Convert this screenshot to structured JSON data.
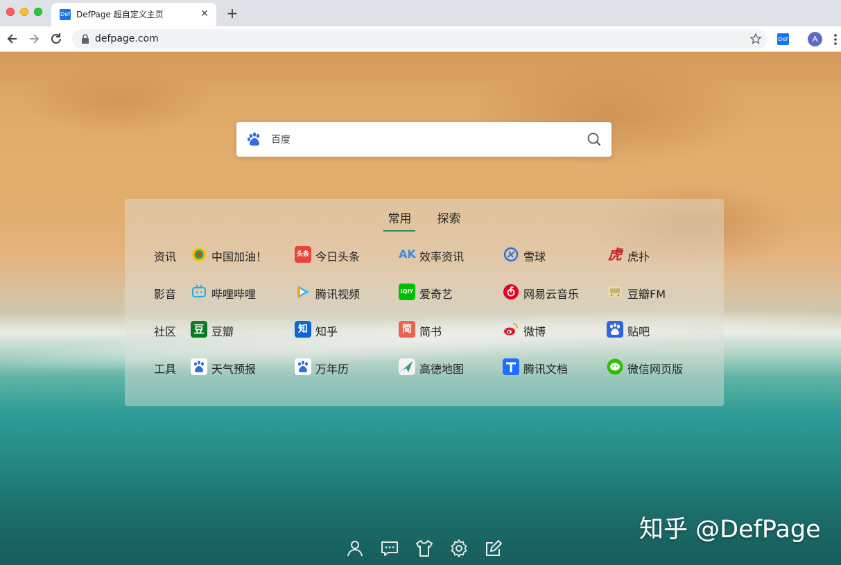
{
  "browser": {
    "tab_title": "DefPage 超自定义主页",
    "tab_favicon_text": "Def",
    "tab_close": "✕",
    "new_tab": "+",
    "url": "defpage.com",
    "extension_text": "Def",
    "avatar_initial": "A"
  },
  "search": {
    "engine": "百度",
    "placeholder": "百度"
  },
  "panel": {
    "tabs": [
      "常用",
      "探索"
    ],
    "active_tab": "常用",
    "rows": [
      {
        "label": "资讯",
        "links": [
          {
            "name": "中国加油！",
            "icon": "china-news-icon"
          },
          {
            "name": "今日头条",
            "icon": "toutiao-icon",
            "icon_text": "头条"
          },
          {
            "name": "效率资讯",
            "icon": "ak-icon",
            "icon_text": "AK"
          },
          {
            "name": "雪球",
            "icon": "xueqiu-icon"
          },
          {
            "name": "虎扑",
            "icon": "hupu-icon",
            "icon_text": "虎"
          }
        ]
      },
      {
        "label": "影音",
        "links": [
          {
            "name": "哔哩哔哩",
            "icon": "bilibili-icon"
          },
          {
            "name": "腾讯视频",
            "icon": "tencent-video-icon"
          },
          {
            "name": "爱奇艺",
            "icon": "iqiyi-icon",
            "icon_text": "iQIY"
          },
          {
            "name": "网易云音乐",
            "icon": "netease-music-icon"
          },
          {
            "name": "豆瓣FM",
            "icon": "douban-fm-icon"
          }
        ]
      },
      {
        "label": "社区",
        "links": [
          {
            "name": "豆瓣",
            "icon": "douban-icon",
            "icon_text": "豆"
          },
          {
            "name": "知乎",
            "icon": "zhihu-icon",
            "icon_text": "知"
          },
          {
            "name": "简书",
            "icon": "jianshu-icon",
            "icon_text": "简"
          },
          {
            "name": "微博",
            "icon": "weibo-icon"
          },
          {
            "name": "贴吧",
            "icon": "tieba-icon"
          }
        ]
      },
      {
        "label": "工具",
        "links": [
          {
            "name": "天气预报",
            "icon": "baidu-paw-icon"
          },
          {
            "name": "万年历",
            "icon": "baidu-paw-icon"
          },
          {
            "name": "高德地图",
            "icon": "amap-icon"
          },
          {
            "name": "腾讯文档",
            "icon": "tencent-docs-icon"
          },
          {
            "name": "微信网页版",
            "icon": "wechat-icon"
          }
        ]
      }
    ]
  },
  "footer_icons": [
    "user-icon",
    "message-icon",
    "tshirt-icon",
    "gear-icon",
    "edit-icon"
  ],
  "watermark": "知乎 @DefPage",
  "colors": {
    "accent": "#2e8b57",
    "chrome_bg": "#dee1e6",
    "baidu_blue": "#2f6fe0"
  }
}
